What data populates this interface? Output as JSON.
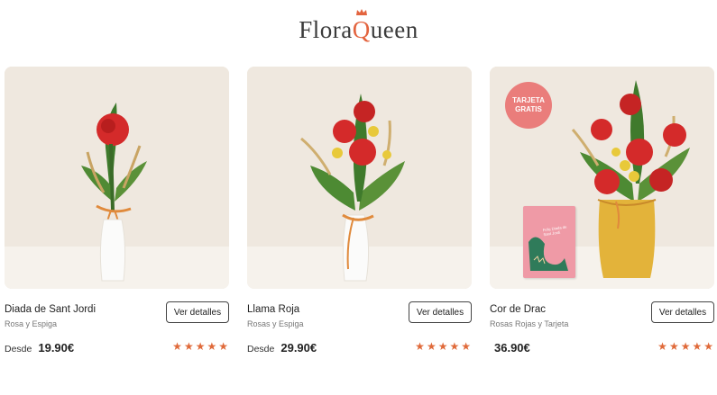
{
  "brand": {
    "name_pre": "Flora",
    "name_q": "Q",
    "name_post": "ueen",
    "accent": "#e3643f"
  },
  "products": [
    {
      "name": "Diada de Sant Jordi",
      "subtitle": "Rosa y Espiga",
      "button": "Ver detalles",
      "price_prefix": "Desde",
      "price": "19.90€",
      "rating": 5
    },
    {
      "name": "Llama Roja",
      "subtitle": "Rosas y Espiga",
      "button": "Ver detalles",
      "price_prefix": "Desde",
      "price": "29.90€",
      "rating": 5
    },
    {
      "name": "Cor de Drac",
      "subtitle": "Rosas Rojas y Tarjeta",
      "button": "Ver detalles",
      "price_prefix": "",
      "price": "36.90€",
      "rating": 5,
      "badge_line1": "TARJETA",
      "badge_line2": "GRATIS",
      "card_text": "Feliç Diada de Sant Jordi"
    }
  ],
  "colors": {
    "star": "#e06a3a",
    "rose": "#d42a2a",
    "badge": "#ea7d7b",
    "vase_yellow": "#e3b33a"
  },
  "icons": [
    "crown-icon",
    "star-icon"
  ]
}
